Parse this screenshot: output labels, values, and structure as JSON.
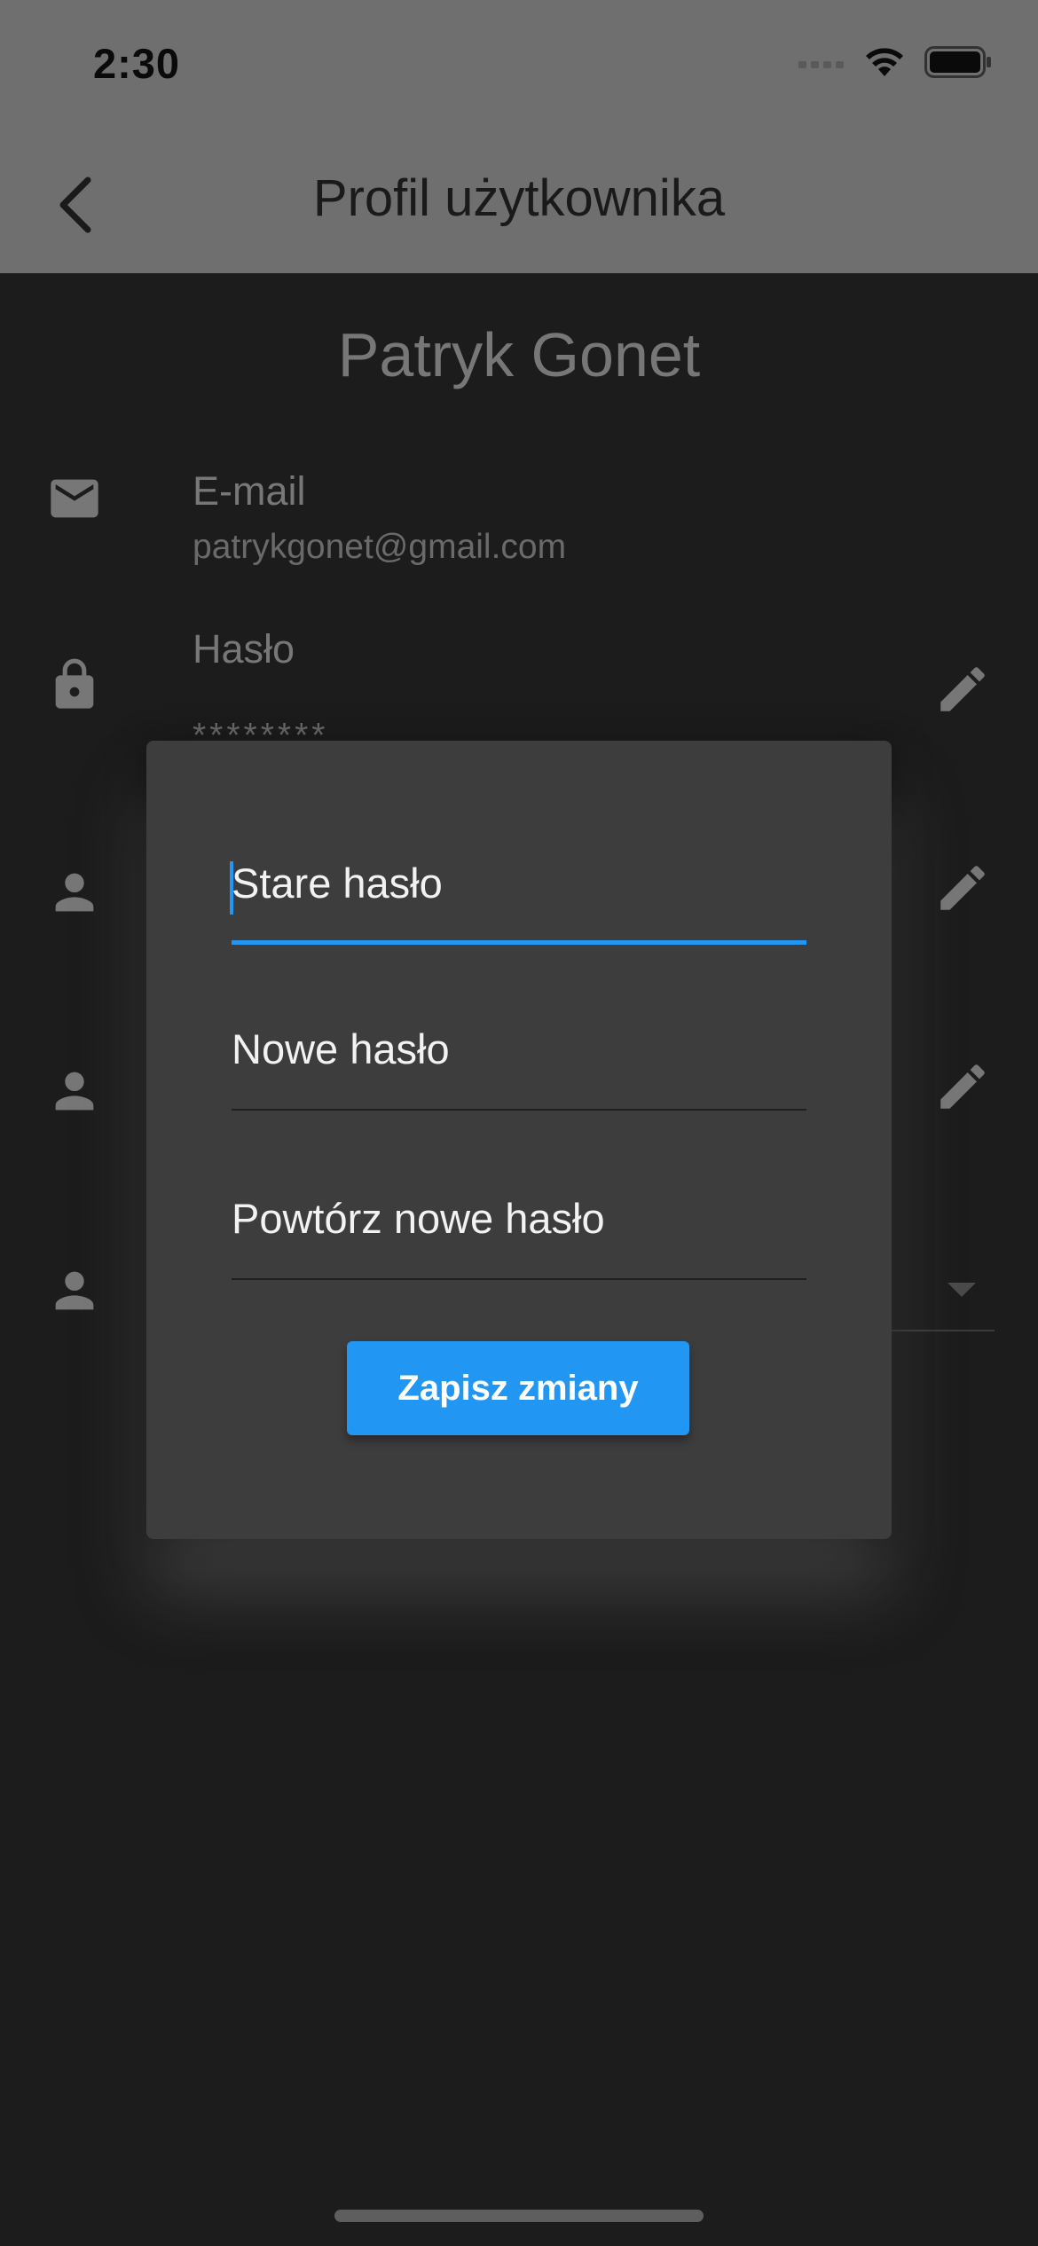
{
  "status_bar": {
    "time": "2:30"
  },
  "app_bar": {
    "title": "Profil użytkownika"
  },
  "profile": {
    "name": "Patryk Gonet",
    "email_label": "E-mail",
    "email_value": "patrykgonet@gmail.com",
    "password_label": "Hasło",
    "password_value": "********"
  },
  "dialog": {
    "old_password_placeholder": "Stare hasło",
    "new_password_placeholder": "Nowe hasło",
    "repeat_password_placeholder": "Powtórz nowe hasło",
    "save_label": "Zapisz zmiany"
  },
  "colors": {
    "accent": "#2196f3",
    "background": "#1c1c1c",
    "app_bar": "#6f6f6f",
    "dialog": "#3d3d3e"
  },
  "icons": [
    "back-chevron-icon",
    "mail-icon",
    "lock-icon",
    "person-icon",
    "edit-pencil-icon",
    "dropdown-arrow-icon",
    "cellular-signal-icon",
    "wifi-icon",
    "battery-icon"
  ]
}
